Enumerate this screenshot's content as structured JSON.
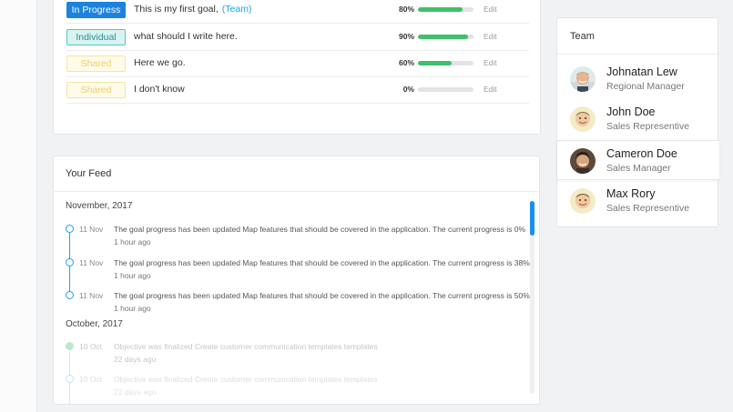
{
  "goals": [
    {
      "badge": "In Progress",
      "badge_style": "progress",
      "title": "This is my first goal,",
      "team_tag": "(Team)",
      "percent": "80%",
      "progress": 80,
      "edit": "Edit"
    },
    {
      "badge": "Individual",
      "badge_style": "individual",
      "title": "what should I write here.",
      "team_tag": "",
      "percent": "90%",
      "progress": 90,
      "edit": "Edit"
    },
    {
      "badge": "Shared",
      "badge_style": "shared",
      "title": "Here we go.",
      "team_tag": "",
      "percent": "60%",
      "progress": 60,
      "edit": "Edit"
    },
    {
      "badge": "Shared",
      "badge_style": "shared",
      "title": "I don't know",
      "team_tag": "",
      "percent": "0%",
      "progress": 0,
      "edit": "Edit"
    }
  ],
  "feed": {
    "title": "Your Feed",
    "months": [
      {
        "label": "November, 2017",
        "events": [
          {
            "date": "11 Nov",
            "text": "The goal progress has been updated Map features that should be covered in the application. The current progress is 0%",
            "ago": "1 hour ago"
          },
          {
            "date": "11 Nov",
            "text": "The goal progress has been updated Map features that should be covered in the application. The current progress is 38%",
            "ago": "1 hour ago"
          },
          {
            "date": "11 Nov",
            "text": "The goal progress has been updated Map features that should be covered in the application. The current progress is 50%",
            "ago": "1 hour ago"
          }
        ]
      },
      {
        "label": "October, 2017",
        "events": [
          {
            "date": "10 Oct",
            "text": "Objective was finalized Create customer communication templates templates",
            "ago": "22 days ago"
          },
          {
            "date": "10 Oct",
            "text": "Objective was finalized Create customer communication templates templates",
            "ago": "22 days ago"
          }
        ]
      }
    ]
  },
  "team": {
    "title": "Team",
    "members": [
      {
        "name": "Johnatan Lew",
        "role": "Regional Manager"
      },
      {
        "name": "John Doe",
        "role": "Sales Representive"
      },
      {
        "name": "Cameron Doe",
        "role": "Sales Manager"
      },
      {
        "name": "Max Rory",
        "role": "Sales Representive"
      }
    ]
  },
  "colors": {
    "accent": "#1b82e0",
    "progress_fill": "#3fc06b",
    "timeline": "#1ba3e6",
    "team_link": "#1ba3e6"
  }
}
